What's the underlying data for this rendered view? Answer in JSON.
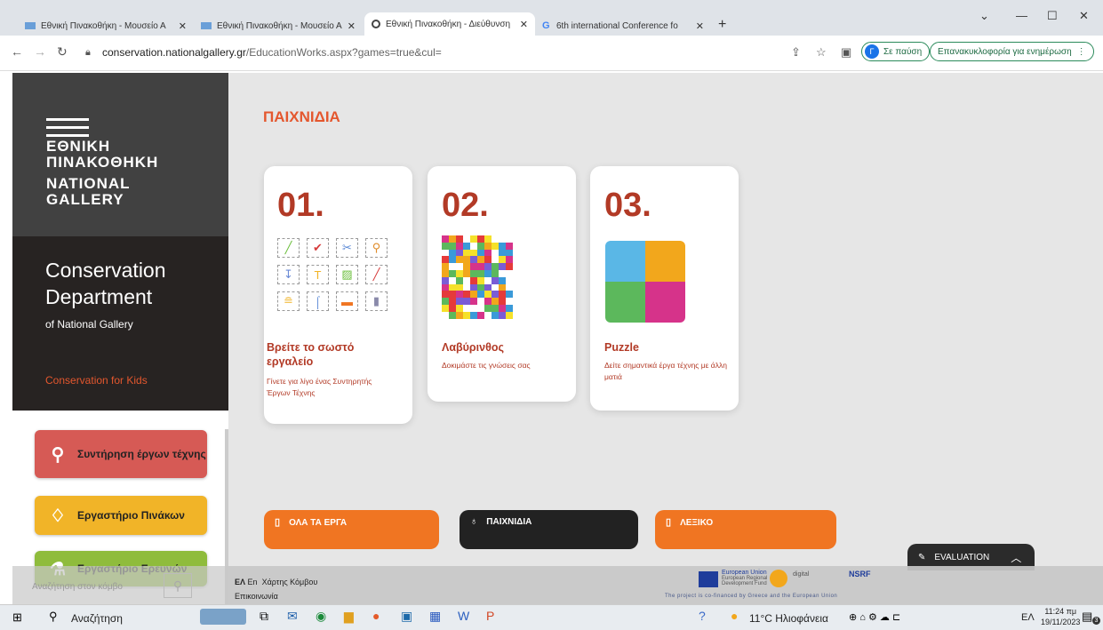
{
  "browser": {
    "tabs": [
      {
        "label": "Εθνική Πινακοθήκη - Μουσείο Α",
        "active": false
      },
      {
        "label": "Εθνική Πινακοθήκη - Μουσείο Α",
        "active": false
      },
      {
        "label": "Εθνική Πινακοθήκη - Διεύθυνση",
        "active": true
      },
      {
        "label": "6th international Conference fo",
        "active": false
      }
    ],
    "new_tab": "+",
    "url_domain": "conservation.nationalgallery.gr",
    "url_path": "/EducationWorks.aspx?games=true&cul=",
    "profile_initial": "Γ",
    "profile_status": "Σε παύση",
    "update_label": "Επανακυκλοφορία για ενημέρωση"
  },
  "sidebar": {
    "logo_gr": [
      "ΕΘΝΙΚΗ",
      "ΠΙΝΑΚΟΘΗΚΗ"
    ],
    "logo_en": [
      "NATIONAL",
      "GALLERY"
    ],
    "dept_title": [
      "Conservation",
      "Department"
    ],
    "dept_sub": "of National Gallery",
    "kids_link": "Conservation for Kids",
    "buttons": [
      {
        "label": "Συντήρηση έργων τέχνης",
        "color": "#d65a55"
      },
      {
        "label": "Εργαστήριο Πινάκων",
        "color": "#f1b428"
      },
      {
        "label": "Εργαστήριο Ερευνών",
        "color": "#8fbc3c"
      }
    ],
    "search_placeholder": "Αναζήτηση στον κόμβο"
  },
  "main": {
    "heading": "ΠΑΙΧΝΙΔΙΑ",
    "cards": [
      {
        "num": "01.",
        "title": "Βρείτε το σωστό εργαλείο",
        "desc": "Γίνετε για λίγο ένας Συντηρητής Έργων Τέχνης"
      },
      {
        "num": "02.",
        "title": "Λαβύρινθος",
        "desc": "Δοκιμάστε τις γνώσεις σας"
      },
      {
        "num": "03.",
        "title": "Puzzle",
        "desc": "Δείτε σημαντικά έργα τέχνης με άλλη ματιά"
      }
    ],
    "bottom_buttons": [
      {
        "label": "ΟΛΑ ΤΑ ΕΡΓΑ",
        "color": "#f07522"
      },
      {
        "label": "ΠΑΙΧΝΙΔΙΑ",
        "color": "#222222"
      },
      {
        "label": "ΛΕΞΙΚΟ",
        "color": "#f07522"
      }
    ],
    "evaluation": "EVALUATION"
  },
  "footer": {
    "lang_el": "ΕΛ",
    "lang_en": "En",
    "sitemap": "Χάρτης Κόμβου",
    "contact": "Επικοινωνία",
    "eu_title": "European Union",
    "eu_fund": "European Regional Development Fund",
    "digital": "digital",
    "nsrf": "NSRF",
    "cofinanced": "The project is co-financed by Greece and the European Union"
  },
  "taskbar": {
    "search": "Αναζήτηση",
    "weather": "11°C Ηλιοφάνεια",
    "lang": "ΕΛ",
    "time": "11:24 πμ",
    "date": "19/11/2023",
    "notif_count": "3"
  }
}
